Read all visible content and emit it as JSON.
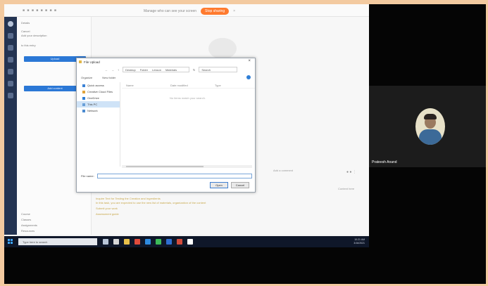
{
  "screen_share": {
    "banner_text": "Manage who can see your screen",
    "banner_button": "Stop sharing",
    "banner_close": "×",
    "left_panel_lines": [
      "Details",
      "Cancel",
      "Add your description",
      "to this entry"
    ],
    "left_panel_buttons": [
      "Upload",
      "Add content"
    ],
    "left_panel_footer": [
      "Course",
      "Classes",
      "Assignments",
      "Resources"
    ],
    "dialog": {
      "title": "File Upload",
      "address_parts": [
        "Desktop",
        "Folder",
        "Lesson",
        "Materials"
      ],
      "search_placeholder": "Search",
      "toolbar": [
        "Organize",
        "New folder"
      ],
      "columns": [
        "Name",
        "Date modified",
        "Type"
      ],
      "empty_text": "No items match your search.",
      "nav_items": [
        "Quick access",
        "Creative Cloud Files",
        "OneDrive",
        "This PC",
        "Network"
      ],
      "selected_nav_index": 3,
      "file_name_label": "File name:",
      "open_button": "Open",
      "cancel_button": "Cancel"
    },
    "main_yellow_lines": [
      "Inquire Text for Testing the Creation and Ingredients",
      "In this task, you are expected to use the new list of materials, organization of the content",
      "Submit your work",
      "Assessment guide"
    ],
    "main_right_texts": [
      "Add a comment",
      "Content here"
    ],
    "taskbar": {
      "search_placeholder": "Type here to search",
      "time": "10:21 AM",
      "date": "3/16/2021",
      "icon_colors": [
        "#b9c6d8",
        "#d7d7d7",
        "#e8c04a",
        "#e04b3b",
        "#2f8be0",
        "#3dbb59",
        "#2f6fd1",
        "#d34b3b",
        "#ffffff"
      ]
    }
  },
  "participant": {
    "name": "Prateesh Anand"
  }
}
